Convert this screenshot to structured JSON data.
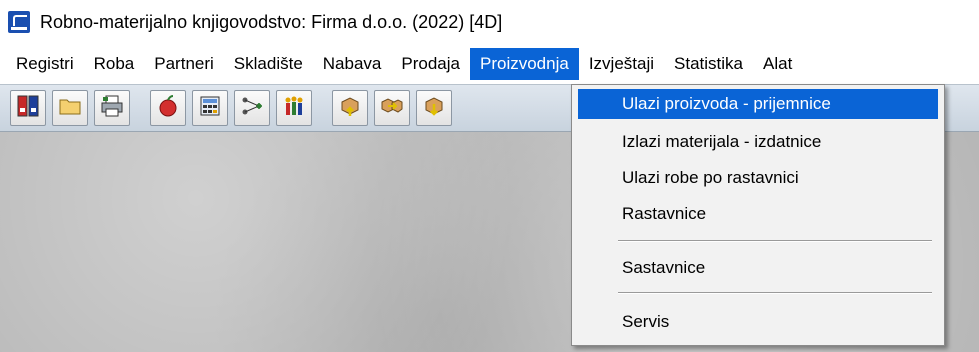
{
  "window": {
    "title": "Robno-materijalno knjigovodstvo: Firma d.o.o. (2022) [4D]"
  },
  "menubar": {
    "items": [
      {
        "label": "Registri"
      },
      {
        "label": "Roba"
      },
      {
        "label": "Partneri"
      },
      {
        "label": "Skladište"
      },
      {
        "label": "Nabava"
      },
      {
        "label": "Prodaja"
      },
      {
        "label": "Proizvodnja"
      },
      {
        "label": "Izvještaji"
      },
      {
        "label": "Statistika"
      },
      {
        "label": "Alat"
      }
    ],
    "active": "Proizvodnja"
  },
  "toolbar": {
    "buttons": [
      {
        "icon": "binders-icon"
      },
      {
        "icon": "folder-icon"
      },
      {
        "icon": "printer-icon"
      },
      {
        "icon": "apple-icon"
      },
      {
        "icon": "calculator-icon"
      },
      {
        "icon": "network-icon"
      },
      {
        "icon": "people-icon"
      },
      {
        "icon": "box-up-icon"
      },
      {
        "icon": "box-right-icon"
      },
      {
        "icon": "box-down-icon"
      }
    ]
  },
  "dropdown": {
    "items": [
      {
        "label": "Ulazi proizvoda - prijemnice",
        "selected": true
      },
      {
        "label": "Izlazi materijala - izdatnice"
      },
      {
        "label": "Ulazi robe po rastavnici"
      },
      {
        "label": "Rastavnice"
      },
      {
        "label": "Sastavnice"
      },
      {
        "label": "Servis"
      }
    ]
  },
  "colors": {
    "highlight": "#0a64d6",
    "workspace": "#b7b7b7"
  }
}
